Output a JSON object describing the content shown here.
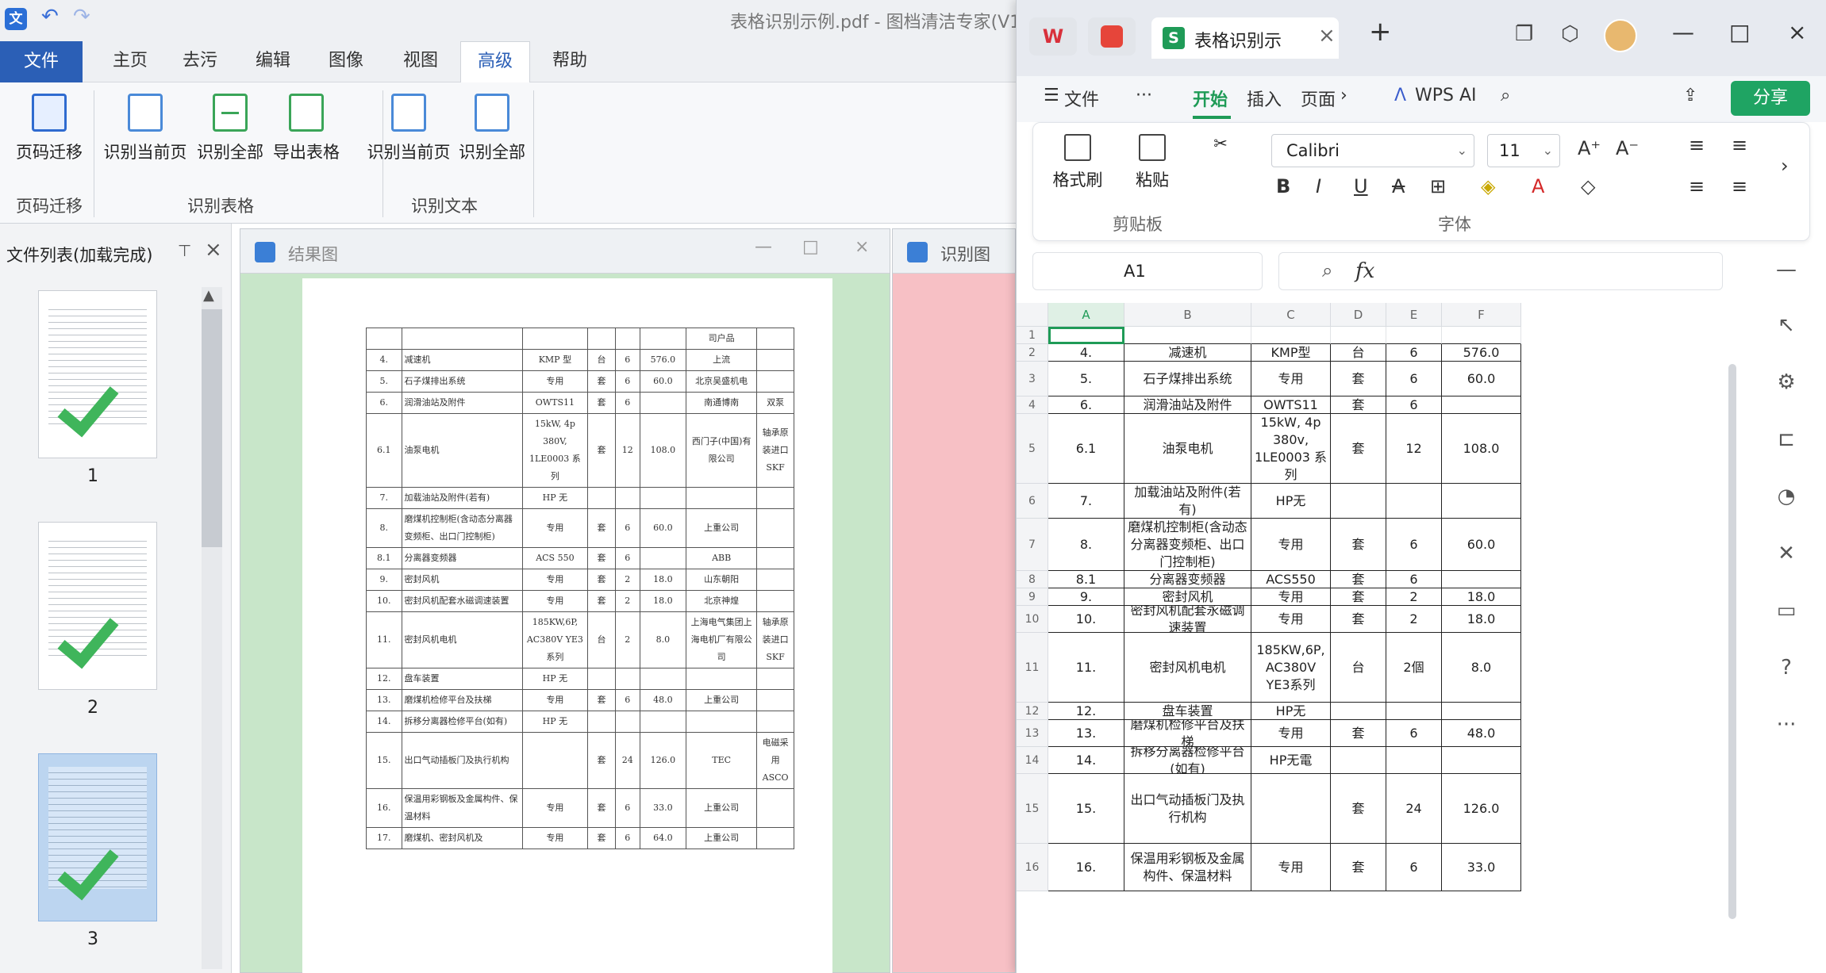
{
  "left_app": {
    "title": "表格识别示例.pdf - 图档清洁专家(V1",
    "menu": [
      "文件",
      "主页",
      "去污",
      "编辑",
      "图像",
      "视图",
      "高级",
      "帮助"
    ],
    "ribbon": {
      "buttons": [
        "页码迁移",
        "识别当前页",
        "识别全部",
        "导出表格",
        "识别当前页",
        "识别全部"
      ],
      "groups": [
        "页码迁移",
        "识别表格",
        "识别文本"
      ]
    },
    "sidebar": {
      "title": "文件列表(加载完成)",
      "pages": [
        "1",
        "2",
        "3"
      ]
    },
    "panels": {
      "result": "结果图",
      "recog": "识别图"
    }
  },
  "doc_table": [
    [
      "",
      "",
      "",
      "",
      "",
      "",
      "司户品",
      ""
    ],
    [
      "4.",
      "减速机",
      "KMP 型",
      "台",
      "6",
      "576.0",
      "上流",
      ""
    ],
    [
      "5.",
      "石子煤排出系统",
      "专用",
      "套",
      "6",
      "60.0",
      "北京吴盛机电",
      ""
    ],
    [
      "6.",
      "润滑油站及附件",
      "OWTS11",
      "套",
      "6",
      "",
      "南通博南",
      "双泵"
    ],
    [
      "6.1",
      "油泵电机",
      "15kW, 4p 380V, 1LE0003 系列",
      "套",
      "12",
      "108.0",
      "西门子(中国)有限公司",
      "轴承原装进口 SKF"
    ],
    [
      "7.",
      "加载油站及附件(若有)",
      "HP 无",
      "",
      "",
      "",
      "",
      ""
    ],
    [
      "8.",
      "磨煤机控制柜(含动态分离器变频柜、出口门控制柜)",
      "专用",
      "套",
      "6",
      "60.0",
      "上重公司",
      ""
    ],
    [
      "8.1",
      "分离器变频器",
      "ACS 550",
      "套",
      "6",
      "",
      "ABB",
      ""
    ],
    [
      "9.",
      "密封风机",
      "专用",
      "套",
      "2",
      "18.0",
      "山东朝阳",
      ""
    ],
    [
      "10.",
      "密封风机配套水磁调速装置",
      "专用",
      "套",
      "2",
      "18.0",
      "北京神煌",
      ""
    ],
    [
      "11.",
      "密封风机电机",
      "185KW,6P, AC380V YE3 系列",
      "台",
      "2",
      "8.0",
      "上海电气集团上海电机厂有限公司",
      "轴承原装进口 SKF"
    ],
    [
      "12.",
      "盘车装置",
      "HP 无",
      "",
      "",
      "",
      "",
      ""
    ],
    [
      "13.",
      "磨煤机检修平台及扶梯",
      "专用",
      "套",
      "6",
      "48.0",
      "上重公司",
      ""
    ],
    [
      "14.",
      "拆移分离器检修平台(如有)",
      "HP 无",
      "",
      "",
      "",
      "",
      ""
    ],
    [
      "15.",
      "出口气动插板门及执行机构",
      "",
      "套",
      "24",
      "126.0",
      "TEC",
      "电磁采用 ASCO"
    ],
    [
      "16.",
      "保温用彩钢板及金属构件、保温材料",
      "专用",
      "套",
      "6",
      "33.0",
      "上重公司",
      ""
    ],
    [
      "17.",
      "磨煤机、密封风机及",
      "专用",
      "套",
      "6",
      "64.0",
      "上重公司",
      ""
    ]
  ],
  "wps": {
    "tab_title": "表格识别示",
    "menu": {
      "file": "文件",
      "more": "···",
      "start": "开始",
      "insert": "插入",
      "page": "页面",
      "ai": "WPS AI",
      "share": "分享"
    },
    "ribbon": {
      "format_brush": "格式刷",
      "paste": "粘贴",
      "font": "Calibri",
      "size": "11",
      "clipboard": "剪贴板",
      "font_group": "字体"
    },
    "namebox": "A1",
    "fx": "fx",
    "columns": [
      "A",
      "B",
      "C",
      "D",
      "E",
      "F"
    ],
    "rows": [
      "1",
      "2",
      "3",
      "4",
      "5",
      "6",
      "7",
      "8",
      "9",
      "10",
      "11",
      "12",
      "13",
      "14",
      "15",
      "16"
    ],
    "sheet": [
      [
        "",
        "",
        "",
        "",
        "",
        ""
      ],
      [
        "4.",
        "减速机",
        "KMP型",
        "台",
        "6",
        "576.0"
      ],
      [
        "5.",
        "石子煤排出系统",
        "专用",
        "套",
        "6",
        "60.0"
      ],
      [
        "6.",
        "润滑油站及附件",
        "OWTS11",
        "套",
        "6",
        ""
      ],
      [
        "6.1",
        "油泵电机",
        "15kW, 4p 380v, 1LE0003 系列",
        "套",
        "12",
        "108.0"
      ],
      [
        "7.",
        "加载油站及附件(若有)",
        "HP无",
        "",
        "",
        ""
      ],
      [
        "8.",
        "磨煤机控制柜(含动态分离器变频柜、出口门控制柜)",
        "专用",
        "套",
        "6",
        "60.0"
      ],
      [
        "8.1",
        "分离器变频器",
        "ACS550",
        "套",
        "6",
        ""
      ],
      [
        "9.",
        "密封风机",
        "专用",
        "套",
        "2",
        "18.0"
      ],
      [
        "10.",
        "密封风机配套永磁调速装置",
        "专用",
        "套",
        "2",
        "18.0"
      ],
      [
        "11.",
        "密封风机电机",
        "185KW,6P, AC380V YE3系列",
        "台",
        "2個",
        "8.0"
      ],
      [
        "12.",
        "盘车装置",
        "HP无",
        "",
        "",
        ""
      ],
      [
        "13.",
        "磨煤机检修平台及扶梯",
        "专用",
        "套",
        "6",
        "48.0"
      ],
      [
        "14.",
        "拆移分离器检修平台(如有)",
        "HP无電",
        "",
        "",
        ""
      ],
      [
        "15.",
        "出口气动插板门及执行机构",
        "",
        "套",
        "24",
        "126.0"
      ],
      [
        "16.",
        "保温用彩钢板及金属构件、保温材料",
        "专用",
        "套",
        "6",
        "33.0"
      ]
    ]
  }
}
